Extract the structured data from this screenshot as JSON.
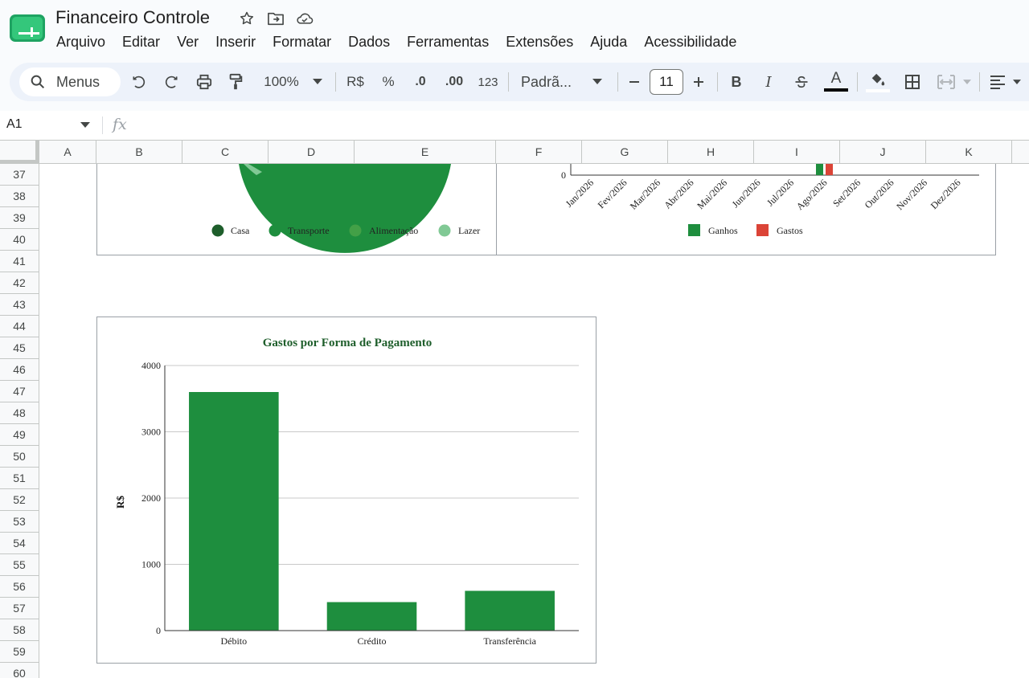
{
  "app": {
    "doc_title": "Financeiro Controle",
    "menu": [
      "Arquivo",
      "Editar",
      "Ver",
      "Inserir",
      "Formatar",
      "Dados",
      "Ferramentas",
      "Extensões",
      "Ajuda",
      "Acessibilidade"
    ]
  },
  "toolbar": {
    "search_label": "Menus",
    "zoom": "100%",
    "currency": "R$",
    "percent": "%",
    "decimal_decrease": ".0",
    "decimal_increase": ".00",
    "more_formats": "123",
    "font": "Padrã...",
    "font_size": "11",
    "bold": "B",
    "italic": "I",
    "text_color": "A"
  },
  "formula_bar": {
    "cell_ref": "A1",
    "fx": "fx"
  },
  "columns": [
    "A",
    "B",
    "C",
    "D",
    "E",
    "F",
    "G",
    "H",
    "I",
    "J",
    "K"
  ],
  "rows": [
    "37",
    "38",
    "39",
    "40",
    "41",
    "42",
    "43",
    "44",
    "45",
    "46",
    "47",
    "48",
    "49",
    "50",
    "51",
    "52",
    "53",
    "54",
    "55",
    "56",
    "57",
    "58",
    "59",
    "60"
  ],
  "colors": {
    "green_dark": "#1e5e2b",
    "green": "#1e8e3e",
    "green_mid": "#43a047",
    "green_light": "#81c995",
    "red": "#db4437"
  },
  "chart_data": [
    {
      "type": "pie",
      "labels": [
        "Casa",
        "Transporte",
        "Alimentação",
        "Lazer"
      ],
      "legend_placement": "bottom",
      "colors": [
        "#1e5e2b",
        "#1e8e3e",
        "#43a047",
        "#81c995"
      ]
    },
    {
      "type": "bar",
      "categories": [
        "Jan/2026",
        "Fev/2026",
        "Mar/2026",
        "Abr/2026",
        "Mai/2026",
        "Jun/2026",
        "Jul/2026",
        "Ago/2026",
        "Set/2026",
        "Out/2026",
        "Nov/2026",
        "Dez/2026"
      ],
      "series": [
        {
          "name": "Ganhos",
          "color": "#1e8e3e"
        },
        {
          "name": "Gastos",
          "color": "#db4437"
        }
      ],
      "y_tick_visible": "0",
      "legend_placement": "bottom"
    },
    {
      "type": "bar",
      "title": "Gastos por Forma de Pagamento",
      "categories": [
        "Débito",
        "Crédito",
        "Transferência"
      ],
      "values": [
        3600,
        430,
        600
      ],
      "ylabel": "R$",
      "ylim": [
        0,
        4000
      ],
      "yticks": [
        0,
        1000,
        2000,
        3000,
        4000
      ],
      "color": "#1e8e3e",
      "grid": true
    }
  ]
}
